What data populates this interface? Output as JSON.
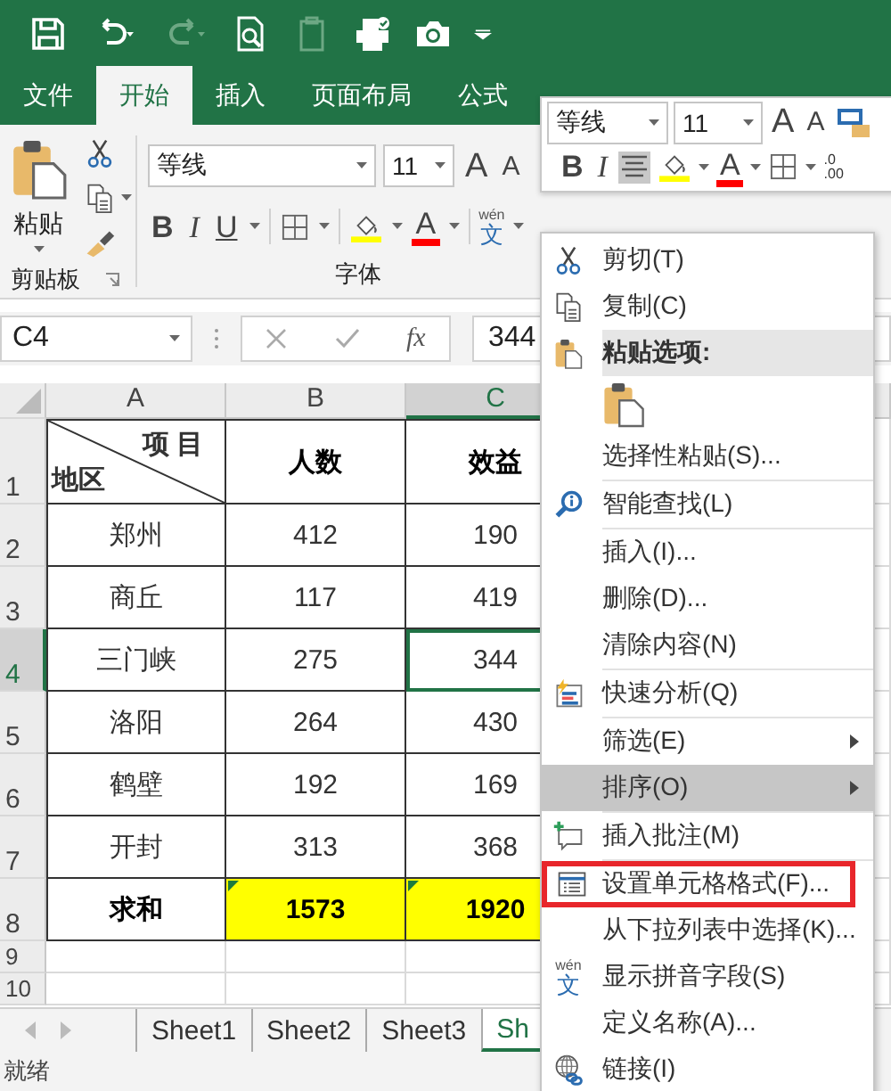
{
  "quick_access": [
    {
      "kind": "save",
      "disabled": false
    },
    {
      "kind": "undo",
      "disabled": false
    },
    {
      "kind": "redo",
      "disabled": true
    },
    {
      "kind": "preview",
      "disabled": false
    },
    {
      "kind": "clipboard-numbers",
      "disabled": true
    },
    {
      "kind": "print",
      "disabled": false
    },
    {
      "kind": "camera",
      "disabled": false
    },
    {
      "kind": "customize",
      "disabled": false
    }
  ],
  "ribbon_tabs": [
    {
      "label": "文件",
      "selected": false
    },
    {
      "label": "开始",
      "selected": true
    },
    {
      "label": "插入",
      "selected": false
    },
    {
      "label": "页面布局",
      "selected": false
    },
    {
      "label": "公式",
      "selected": false
    }
  ],
  "clipboard_group": {
    "paste_label": "粘贴",
    "label": "剪贴板"
  },
  "font_group": {
    "font_name": "等线",
    "font_size": "11",
    "label": "字体",
    "grow_glyph": "A",
    "shrink_glyph": "A",
    "tools": [
      {
        "kind": "bold",
        "glyph": "B"
      },
      {
        "kind": "italic",
        "glyph": "I"
      },
      {
        "kind": "underline",
        "glyph": "U"
      },
      {
        "kind": "borders"
      },
      {
        "kind": "fill"
      },
      {
        "kind": "font-color",
        "glyph": "A"
      },
      {
        "kind": "phonetic",
        "glyph": "文",
        "ruby": "wén"
      }
    ]
  },
  "formula_bar": {
    "name_box": "C4",
    "function_symbol": "fx",
    "value": "344"
  },
  "sheet": {
    "columns": [
      {
        "label": "A",
        "selected": false
      },
      {
        "label": "B",
        "selected": false
      },
      {
        "label": "C",
        "selected": true
      }
    ],
    "rows": [
      {
        "number": "1",
        "selected": false,
        "kind": "header",
        "cells": [
          {
            "kind": "diagonal",
            "top": "项 目",
            "bottom": "地区",
            "selected": false,
            "highlighted": false,
            "flagged": false
          },
          {
            "kind": "text",
            "text": "人数",
            "selected": false,
            "highlighted": false,
            "flagged": false
          },
          {
            "kind": "text",
            "text": "效益",
            "selected": false,
            "highlighted": false,
            "flagged": false
          }
        ]
      },
      {
        "number": "2",
        "selected": false,
        "kind": "data",
        "cells": [
          {
            "kind": "text",
            "text": "郑州",
            "selected": false,
            "highlighted": false,
            "flagged": false
          },
          {
            "kind": "text",
            "text": "412",
            "selected": false,
            "highlighted": false,
            "flagged": false
          },
          {
            "kind": "text",
            "text": "190",
            "selected": false,
            "highlighted": false,
            "flagged": false
          }
        ]
      },
      {
        "number": "3",
        "selected": false,
        "kind": "data",
        "cells": [
          {
            "kind": "text",
            "text": "商丘",
            "selected": false,
            "highlighted": false,
            "flagged": false
          },
          {
            "kind": "text",
            "text": "117",
            "selected": false,
            "highlighted": false,
            "flagged": false
          },
          {
            "kind": "text",
            "text": "419",
            "selected": false,
            "highlighted": false,
            "flagged": false
          }
        ]
      },
      {
        "number": "4",
        "selected": true,
        "kind": "data",
        "cells": [
          {
            "kind": "text",
            "text": "三门峡",
            "selected": false,
            "highlighted": false,
            "flagged": false
          },
          {
            "kind": "text",
            "text": "275",
            "selected": false,
            "highlighted": false,
            "flagged": false
          },
          {
            "kind": "text",
            "text": "344",
            "selected": true,
            "highlighted": false,
            "flagged": false
          }
        ]
      },
      {
        "number": "5",
        "selected": false,
        "kind": "data",
        "cells": [
          {
            "kind": "text",
            "text": "洛阳",
            "selected": false,
            "highlighted": false,
            "flagged": false
          },
          {
            "kind": "text",
            "text": "264",
            "selected": false,
            "highlighted": false,
            "flagged": false
          },
          {
            "kind": "text",
            "text": "430",
            "selected": false,
            "highlighted": false,
            "flagged": false
          }
        ]
      },
      {
        "number": "6",
        "selected": false,
        "kind": "data",
        "cells": [
          {
            "kind": "text",
            "text": "鹤壁",
            "selected": false,
            "highlighted": false,
            "flagged": false
          },
          {
            "kind": "text",
            "text": "192",
            "selected": false,
            "highlighted": false,
            "flagged": false
          },
          {
            "kind": "text",
            "text": "169",
            "selected": false,
            "highlighted": false,
            "flagged": false
          }
        ]
      },
      {
        "number": "7",
        "selected": false,
        "kind": "data",
        "cells": [
          {
            "kind": "text",
            "text": "开封",
            "selected": false,
            "highlighted": false,
            "flagged": false
          },
          {
            "kind": "text",
            "text": "313",
            "selected": false,
            "highlighted": false,
            "flagged": false
          },
          {
            "kind": "text",
            "text": "368",
            "selected": false,
            "highlighted": false,
            "flagged": false
          }
        ]
      },
      {
        "number": "8",
        "selected": false,
        "kind": "total",
        "cells": [
          {
            "kind": "text",
            "text": "求和",
            "selected": false,
            "highlighted": false,
            "flagged": false
          },
          {
            "kind": "text",
            "text": "1573",
            "selected": false,
            "highlighted": true,
            "flagged": true
          },
          {
            "kind": "text",
            "text": "1920",
            "selected": false,
            "highlighted": true,
            "flagged": true
          }
        ]
      },
      {
        "number": "9",
        "selected": false,
        "kind": "empty"
      },
      {
        "number": "10",
        "selected": false,
        "kind": "empty"
      }
    ]
  },
  "sheet_tabs": [
    {
      "label": "Sheet1",
      "selected": false
    },
    {
      "label": "Sheet2",
      "selected": false
    },
    {
      "label": "Sheet3",
      "selected": false
    },
    {
      "label": "Sh",
      "selected": true
    }
  ],
  "status_bar": "就绪",
  "mini_toolbar": {
    "font_name": "等线",
    "font_size": "11",
    "tools": [
      {
        "kind": "grow",
        "glyph": "A",
        "on": false
      },
      {
        "kind": "shrink",
        "glyph": "A",
        "on": false
      },
      {
        "kind": "format",
        "on": false
      },
      {
        "kind": "bold",
        "glyph": "B",
        "on": false
      },
      {
        "kind": "italic",
        "glyph": "I",
        "on": false
      },
      {
        "kind": "center",
        "on": true
      },
      {
        "kind": "fill",
        "on": false
      },
      {
        "kind": "font-color",
        "glyph": "A",
        "on": false
      },
      {
        "kind": "borders",
        "on": false
      },
      {
        "kind": "decimal",
        "lines": [
          ".0",
          ".00"
        ],
        "on": false
      }
    ]
  },
  "context_menu": {
    "groups": [
      [
        {
          "kind": "item",
          "label": "剪切(T)",
          "hovered": false,
          "submenu": false,
          "outlined": false
        },
        {
          "kind": "item",
          "label": "复制(C)",
          "hovered": false,
          "submenu": false,
          "outlined": false
        },
        {
          "kind": "header",
          "label": "粘贴选项:"
        },
        {
          "kind": "paste-options"
        },
        {
          "kind": "item",
          "label": "选择性粘贴(S)...",
          "hovered": false,
          "submenu": false,
          "outlined": false
        }
      ],
      [
        {
          "kind": "item",
          "label": "智能查找(L)",
          "hovered": false,
          "submenu": false,
          "outlined": false
        }
      ],
      [
        {
          "kind": "item",
          "label": "插入(I)...",
          "hovered": false,
          "submenu": false,
          "outlined": false
        },
        {
          "kind": "item",
          "label": "删除(D)...",
          "hovered": false,
          "submenu": false,
          "outlined": false
        },
        {
          "kind": "item",
          "label": "清除内容(N)",
          "hovered": false,
          "submenu": false,
          "outlined": false
        }
      ],
      [
        {
          "kind": "item",
          "label": "快速分析(Q)",
          "hovered": false,
          "submenu": false,
          "outlined": false
        }
      ],
      [
        {
          "kind": "item",
          "label": "筛选(E)",
          "hovered": false,
          "submenu": true,
          "outlined": false
        },
        {
          "kind": "item",
          "label": "排序(O)",
          "hovered": true,
          "submenu": true,
          "outlined": false
        }
      ],
      [
        {
          "kind": "item",
          "label": "插入批注(M)",
          "hovered": false,
          "submenu": false,
          "outlined": false
        }
      ],
      [
        {
          "kind": "item",
          "label": "设置单元格格式(F)...",
          "hovered": false,
          "submenu": false,
          "outlined": true
        },
        {
          "kind": "item",
          "label": "从下拉列表中选择(K)...",
          "hovered": false,
          "submenu": false,
          "outlined": false
        },
        {
          "kind": "item",
          "label": "显示拼音字段(S)",
          "hovered": false,
          "submenu": false,
          "outlined": false,
          "glyph": "文",
          "ruby": "wén"
        },
        {
          "kind": "item",
          "label": "定义名称(A)...",
          "hovered": false,
          "submenu": false,
          "outlined": false
        },
        {
          "kind": "item",
          "label": "链接(I)",
          "hovered": false,
          "submenu": false,
          "outlined": false
        }
      ]
    ]
  }
}
